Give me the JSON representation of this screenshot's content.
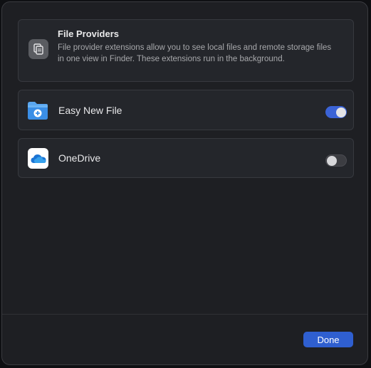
{
  "info": {
    "title": "File Providers",
    "description": "File provider extensions allow you to see local files and remote storage files in one view in Finder. These extensions run in the background.",
    "icon": "documents-icon"
  },
  "extensions": [
    {
      "name": "Easy New File",
      "icon": "blue-folder-plus-icon",
      "enabled": true,
      "accent": "#3b63d6"
    },
    {
      "name": "OneDrive",
      "icon": "onedrive-cloud-icon",
      "enabled": false,
      "accent": "#0f78d4"
    }
  ],
  "footer": {
    "done_label": "Done"
  },
  "colors": {
    "accent": "#2f5fd0",
    "background": "#1e1f23",
    "panel": "#24262b"
  }
}
